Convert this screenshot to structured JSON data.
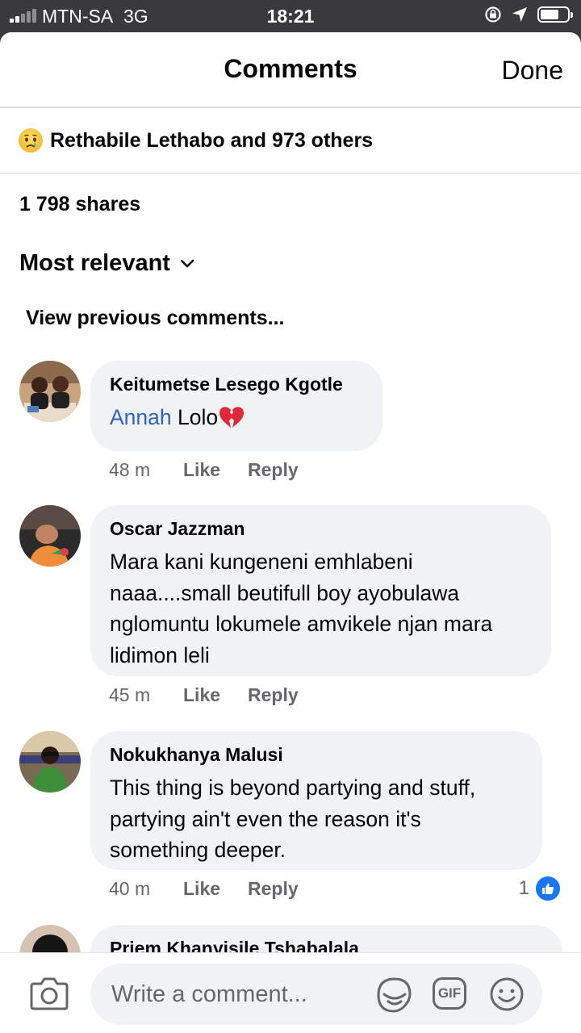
{
  "status_bar": {
    "carrier": "MTN-SA",
    "network": "3G",
    "time": "18:21"
  },
  "header": {
    "title": "Comments",
    "done_label": "Done"
  },
  "reactions": {
    "emoji": "sad-face-icon",
    "summary": "Rethabile Lethabo and 973 others"
  },
  "shares": "1 798 shares",
  "sort": {
    "label": "Most relevant",
    "icon": "chevron-down-icon"
  },
  "view_previous": "View previous comments...",
  "comments": [
    {
      "author": "Keitumetse Lesego Kgotle",
      "mention": "Annah",
      "text": "Lolo",
      "emoji": "broken-heart",
      "time": "48 m",
      "like_label": "Like",
      "reply_label": "Reply"
    },
    {
      "author": "Oscar Jazzman",
      "text": "Mara kani kungeneni emhlabeni naaa....small beutifull boy ayobulawa nglomuntu lokumele amvikele njan mara lidimon leli",
      "time": "45 m",
      "like_label": "Like",
      "reply_label": "Reply"
    },
    {
      "author": "Nokukhanya Malusi",
      "text": "This thing is beyond partying and stuff, partying ain't even the reason it's something deeper.",
      "time": "40 m",
      "like_label": "Like",
      "reply_label": "Reply",
      "reaction_count": "1"
    },
    {
      "author": "Priem Khanyisile Tshabalala"
    }
  ],
  "composer": {
    "placeholder": "Write a comment...",
    "gif_label": "GIF"
  },
  "colors": {
    "mention": "#2f63c2",
    "like_badge": "#1877f2",
    "bubble": "#f0f2f5",
    "meta_text": "#65676b"
  }
}
